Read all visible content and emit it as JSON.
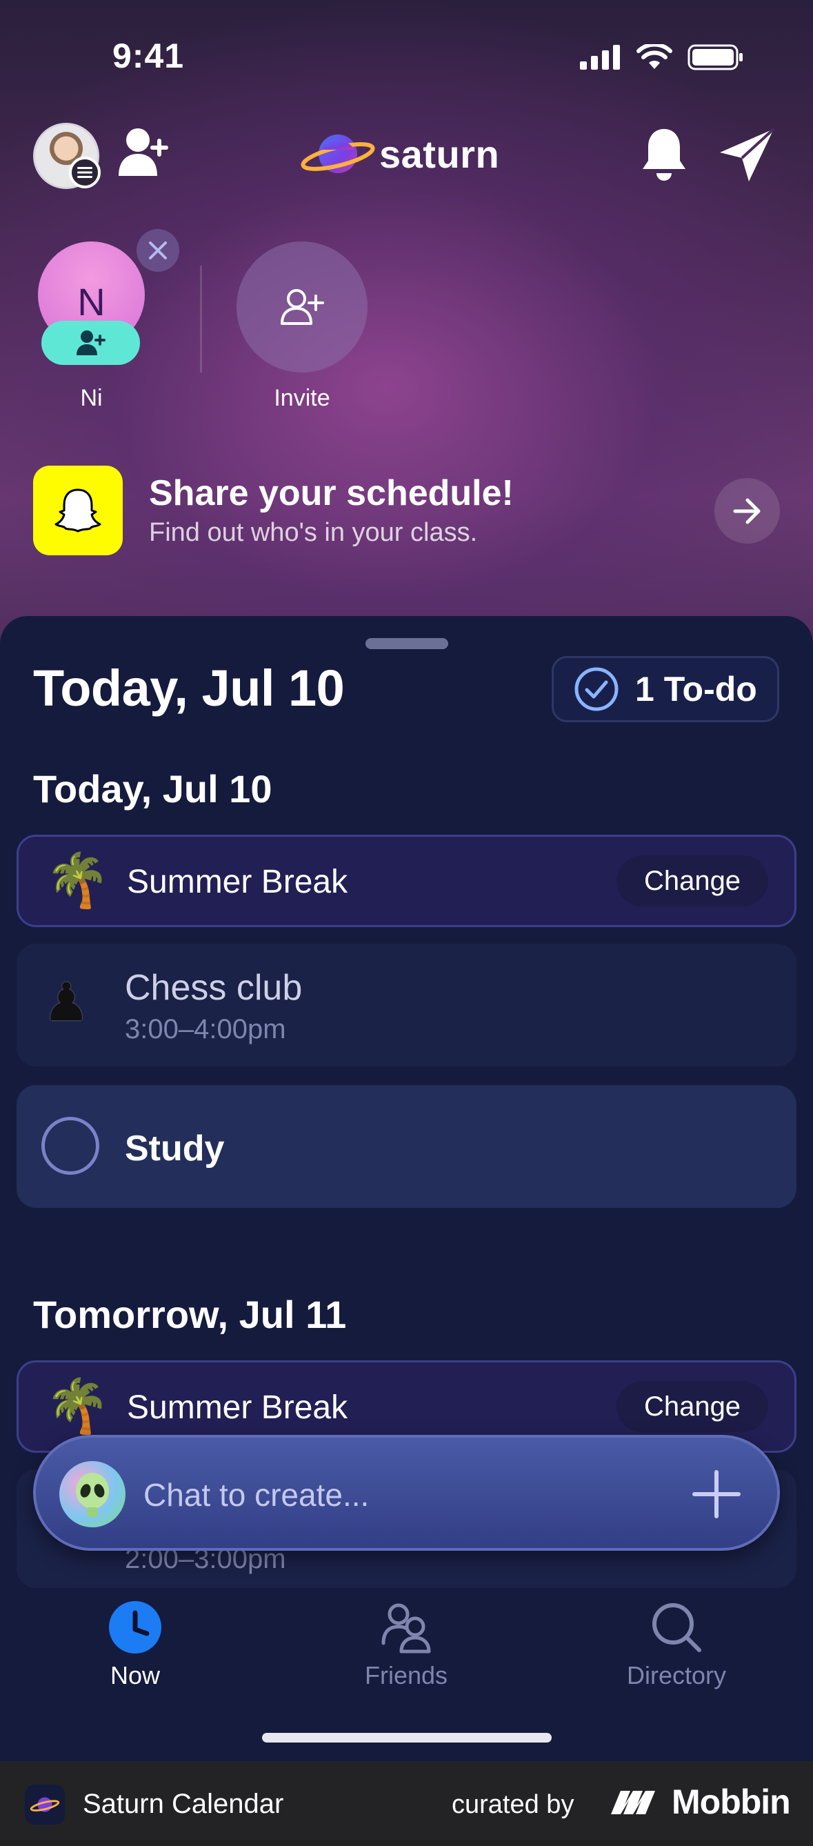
{
  "status_bar": {
    "time": "9:41"
  },
  "header": {
    "app_name": "saturn"
  },
  "stories": [
    {
      "initial": "N",
      "label": "Ni"
    },
    {
      "label": "Invite"
    }
  ],
  "promo": {
    "title": "Share your schedule!",
    "subtitle": "Find out who's in your class."
  },
  "sheet": {
    "title": "Today, Jul 10",
    "todo_button": "1 To-do"
  },
  "days": [
    {
      "heading": "Today, Jul 10",
      "items": [
        {
          "type": "break",
          "emoji": "🌴",
          "title": "Summer Break",
          "action": "Change"
        },
        {
          "type": "event",
          "emoji": "♟",
          "title": "Chess club",
          "time": "3:00–4:00pm"
        },
        {
          "type": "todo",
          "title": "Study"
        }
      ]
    },
    {
      "heading": "Tomorrow, Jul 11",
      "items": [
        {
          "type": "break",
          "emoji": "🌴",
          "title": "Summer Break",
          "action": "Change"
        },
        {
          "type": "event",
          "time": "2:00–3:00pm"
        }
      ]
    }
  ],
  "chat": {
    "placeholder": "Chat to create..."
  },
  "tabs": [
    {
      "label": "Now",
      "icon": "clock-icon",
      "active": true
    },
    {
      "label": "Friends",
      "icon": "friends-icon",
      "active": false
    },
    {
      "label": "Directory",
      "icon": "search-icon",
      "active": false
    }
  ],
  "footer": {
    "app_name": "Saturn Calendar",
    "curated_by": "curated by",
    "brand": "Mobbin"
  },
  "colors": {
    "accent_blue": "#1c7cf4",
    "sheet_bg": "#151b3d",
    "snap_yellow": "#fffc00",
    "invite_teal": "#5fe7d6"
  }
}
